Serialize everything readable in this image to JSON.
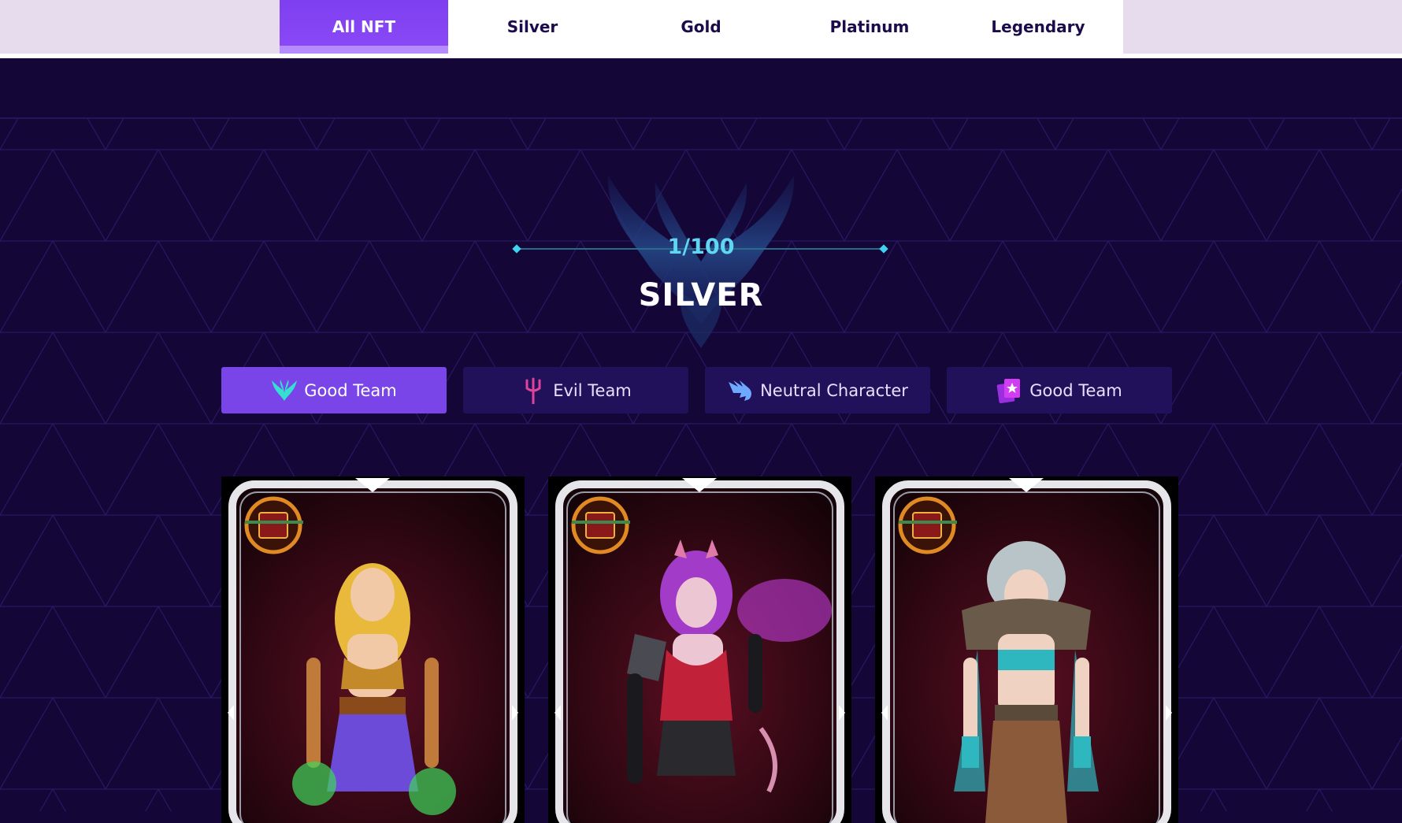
{
  "tabs": [
    {
      "label": "All NFT",
      "active": true
    },
    {
      "label": "Silver",
      "active": false
    },
    {
      "label": "Gold",
      "active": false
    },
    {
      "label": "Platinum",
      "active": false
    },
    {
      "label": "Legendary",
      "active": false
    }
  ],
  "hero": {
    "rank": "1/100",
    "title": "SILVER"
  },
  "filters": [
    {
      "label": "Good Team",
      "icon": "wings-icon",
      "active": true
    },
    {
      "label": "Evil Team",
      "icon": "trident-icon",
      "active": false
    },
    {
      "label": "Neutral Character",
      "icon": "dragon-icon",
      "active": false
    },
    {
      "label": "Good Team",
      "icon": "star-card-icon",
      "active": false
    }
  ],
  "cards": [
    {
      "character": "blonde-warrior",
      "hair_color": "#e8b93a",
      "outfit_color": "#6b4bd8"
    },
    {
      "character": "demon-girl",
      "hair_color": "#a23cc8",
      "outfit_color": "#c2213a"
    },
    {
      "character": "silver-haired-fighter",
      "hair_color": "#b8c4c8",
      "outfit_color": "#2fb7c0"
    }
  ],
  "colors": {
    "background": "#140637",
    "accent": "#7a45e8",
    "filter_bg": "#21105a",
    "rank_text": "#5fd6f2"
  }
}
